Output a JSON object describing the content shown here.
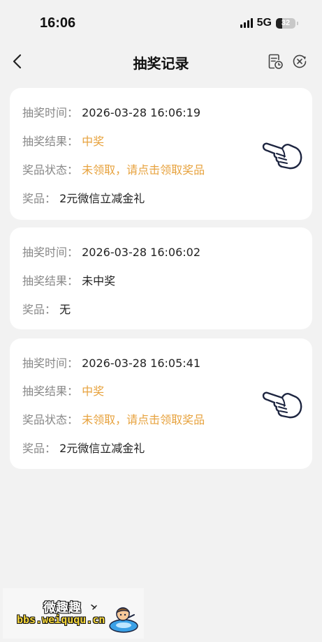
{
  "status": {
    "time": "16:06",
    "network": "5G",
    "battery": "32"
  },
  "nav": {
    "title": "抽奖记录",
    "icons": [
      "back-arrow-icon",
      "document-clock-icon",
      "close-circle-icon"
    ]
  },
  "labels": {
    "time": "抽奖时间：",
    "result": "抽奖结果：",
    "status": "奖品状态：",
    "prize": "奖品："
  },
  "records": [
    {
      "time": "2026-03-28 16:06:19",
      "result": "中奖",
      "status": "未领取，请点击领取奖品",
      "prize": "2元微信立减金礼"
    },
    {
      "time": "2026-03-28 16:06:02",
      "result": "未中奖",
      "prize": "无"
    },
    {
      "time": "2026-03-28 16:05:41",
      "result": "中奖",
      "status": "未领取，请点击领取奖品",
      "prize": "2元微信立减金礼"
    }
  ],
  "colors": {
    "highlight": "#e7a23d",
    "label": "#888888",
    "value": "#222222",
    "background": "#f2f2f2"
  },
  "watermark": {
    "title": "微趣趣",
    "url": "bbs.weiququ.cn"
  }
}
